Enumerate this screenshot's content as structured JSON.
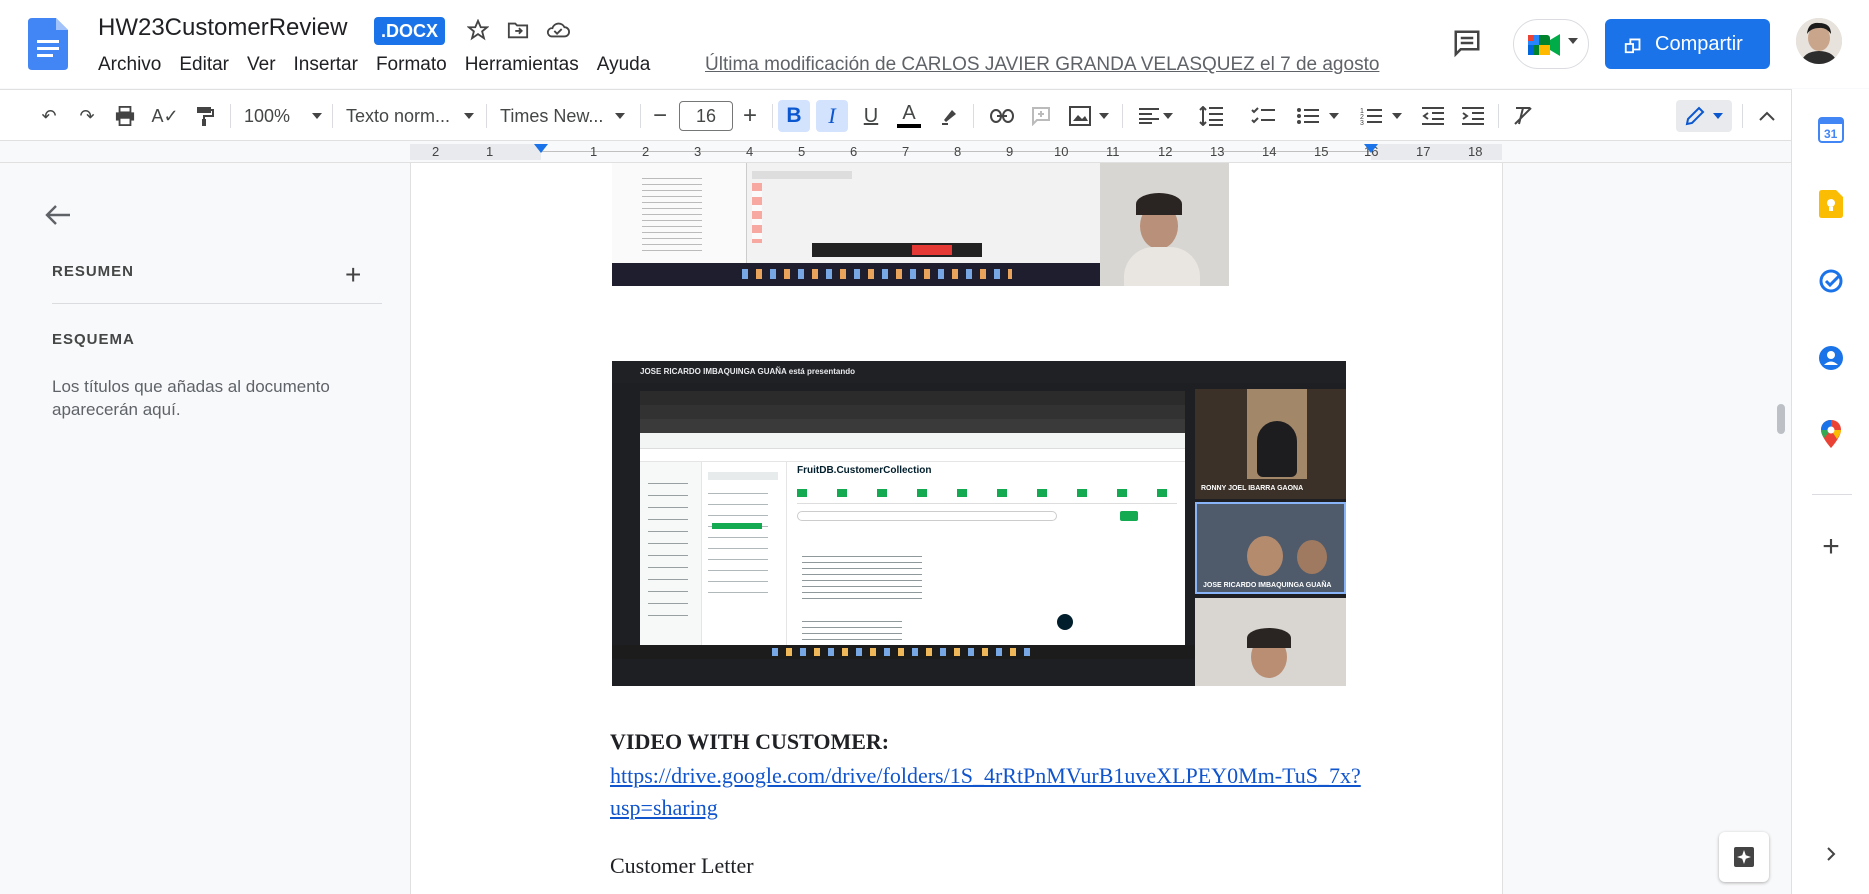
{
  "header": {
    "title": "HW23CustomerReview",
    "badge": ".DOCX",
    "menu": [
      "Archivo",
      "Editar",
      "Ver",
      "Insertar",
      "Formato",
      "Herramientas",
      "Ayuda"
    ],
    "last_modified": "Última modificación de CARLOS JAVIER GRANDA VELASQUEZ el 7 de agosto",
    "share_label": "Compartir"
  },
  "toolbar": {
    "zoom": "100%",
    "style": "Texto norm...",
    "font": "Times New...",
    "font_size": "16"
  },
  "ruler": {
    "ticks": [
      "2",
      "1",
      "1",
      "2",
      "3",
      "4",
      "5",
      "6",
      "7",
      "8",
      "9",
      "10",
      "11",
      "12",
      "13",
      "14",
      "15",
      "16",
      "17",
      "18"
    ]
  },
  "outline": {
    "summary": "RESUMEN",
    "outline": "ESQUEMA",
    "empty": "Los títulos que añadas al documento aparecerán aquí."
  },
  "document": {
    "image2_caption": "JOSE RICARDO IMBAQUINGA GUAÑA está presentando",
    "image2_collection": "FruitDB.CustomerCollection",
    "participants": [
      "RONNY JOEL IBARRA GAONA",
      "JOSE RICARDO IMBAQUINGA GUAÑA"
    ],
    "heading": "VIDEO WITH CUSTOMER:",
    "link": "https://drive.google.com/drive/folders/1S_4rRtPnMVurB1uveXLPEY0Mm-TuS_7x?usp=sharing",
    "paragraph": "Customer Letter"
  },
  "colors": {
    "accent": "#1a73e8",
    "link": "#1155cc"
  }
}
